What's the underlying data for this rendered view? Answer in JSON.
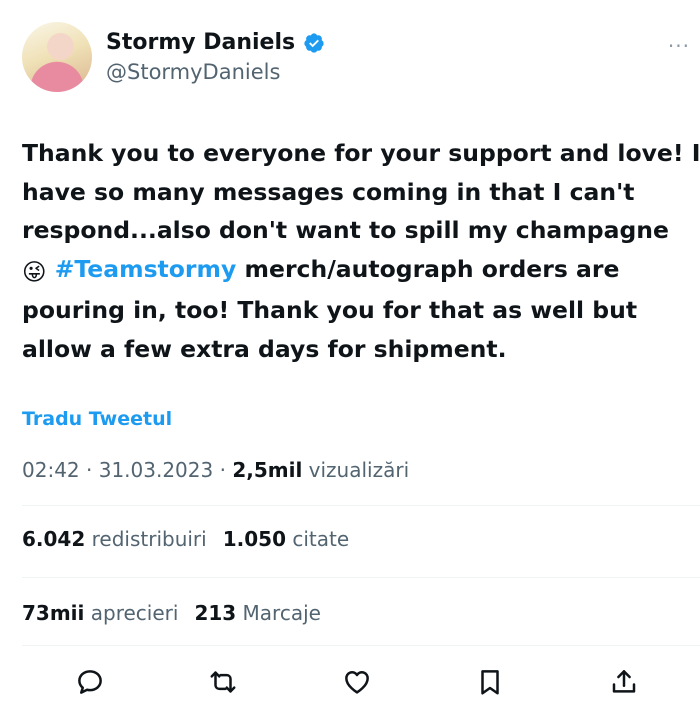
{
  "author": {
    "display_name": "Stormy Daniels",
    "handle": "@StormyDaniels"
  },
  "more_label": "···",
  "tweet": {
    "lines": [
      "Thank you to everyone for your support and love! I",
      "have so many messages coming in that I can't",
      "respond...also don't want to spill my champagne"
    ],
    "line4_emoji": "😜",
    "hashtag": "#Teamstormy",
    "line4_rest": " merch/autograph orders are",
    "lines_after": [
      "pouring in, too! Thank you for that as well but",
      "allow a few extra days for shipment."
    ]
  },
  "translate_label": "Tradu Tweetul",
  "meta": {
    "time": "02:42",
    "sep1": " · ",
    "date": "31.03.2023",
    "sep2": " · ",
    "views_count": "2,5mil",
    "views_label": " vizualizări"
  },
  "stats": {
    "retweets_count": "6.042",
    "retweets_label": " redistribuiri",
    "quotes_count": "1.050",
    "quotes_label": " citate",
    "likes_count": "73mii",
    "likes_label": " aprecieri",
    "bookmarks_count": "213",
    "bookmarks_label": " Marcaje"
  },
  "colors": {
    "accent": "#1d9bf0",
    "text": "#0f1419",
    "secondary": "#536471",
    "divider": "#eff3f4"
  },
  "icons": [
    "reply-icon",
    "retweet-icon",
    "like-icon",
    "bookmark-icon",
    "share-icon"
  ]
}
